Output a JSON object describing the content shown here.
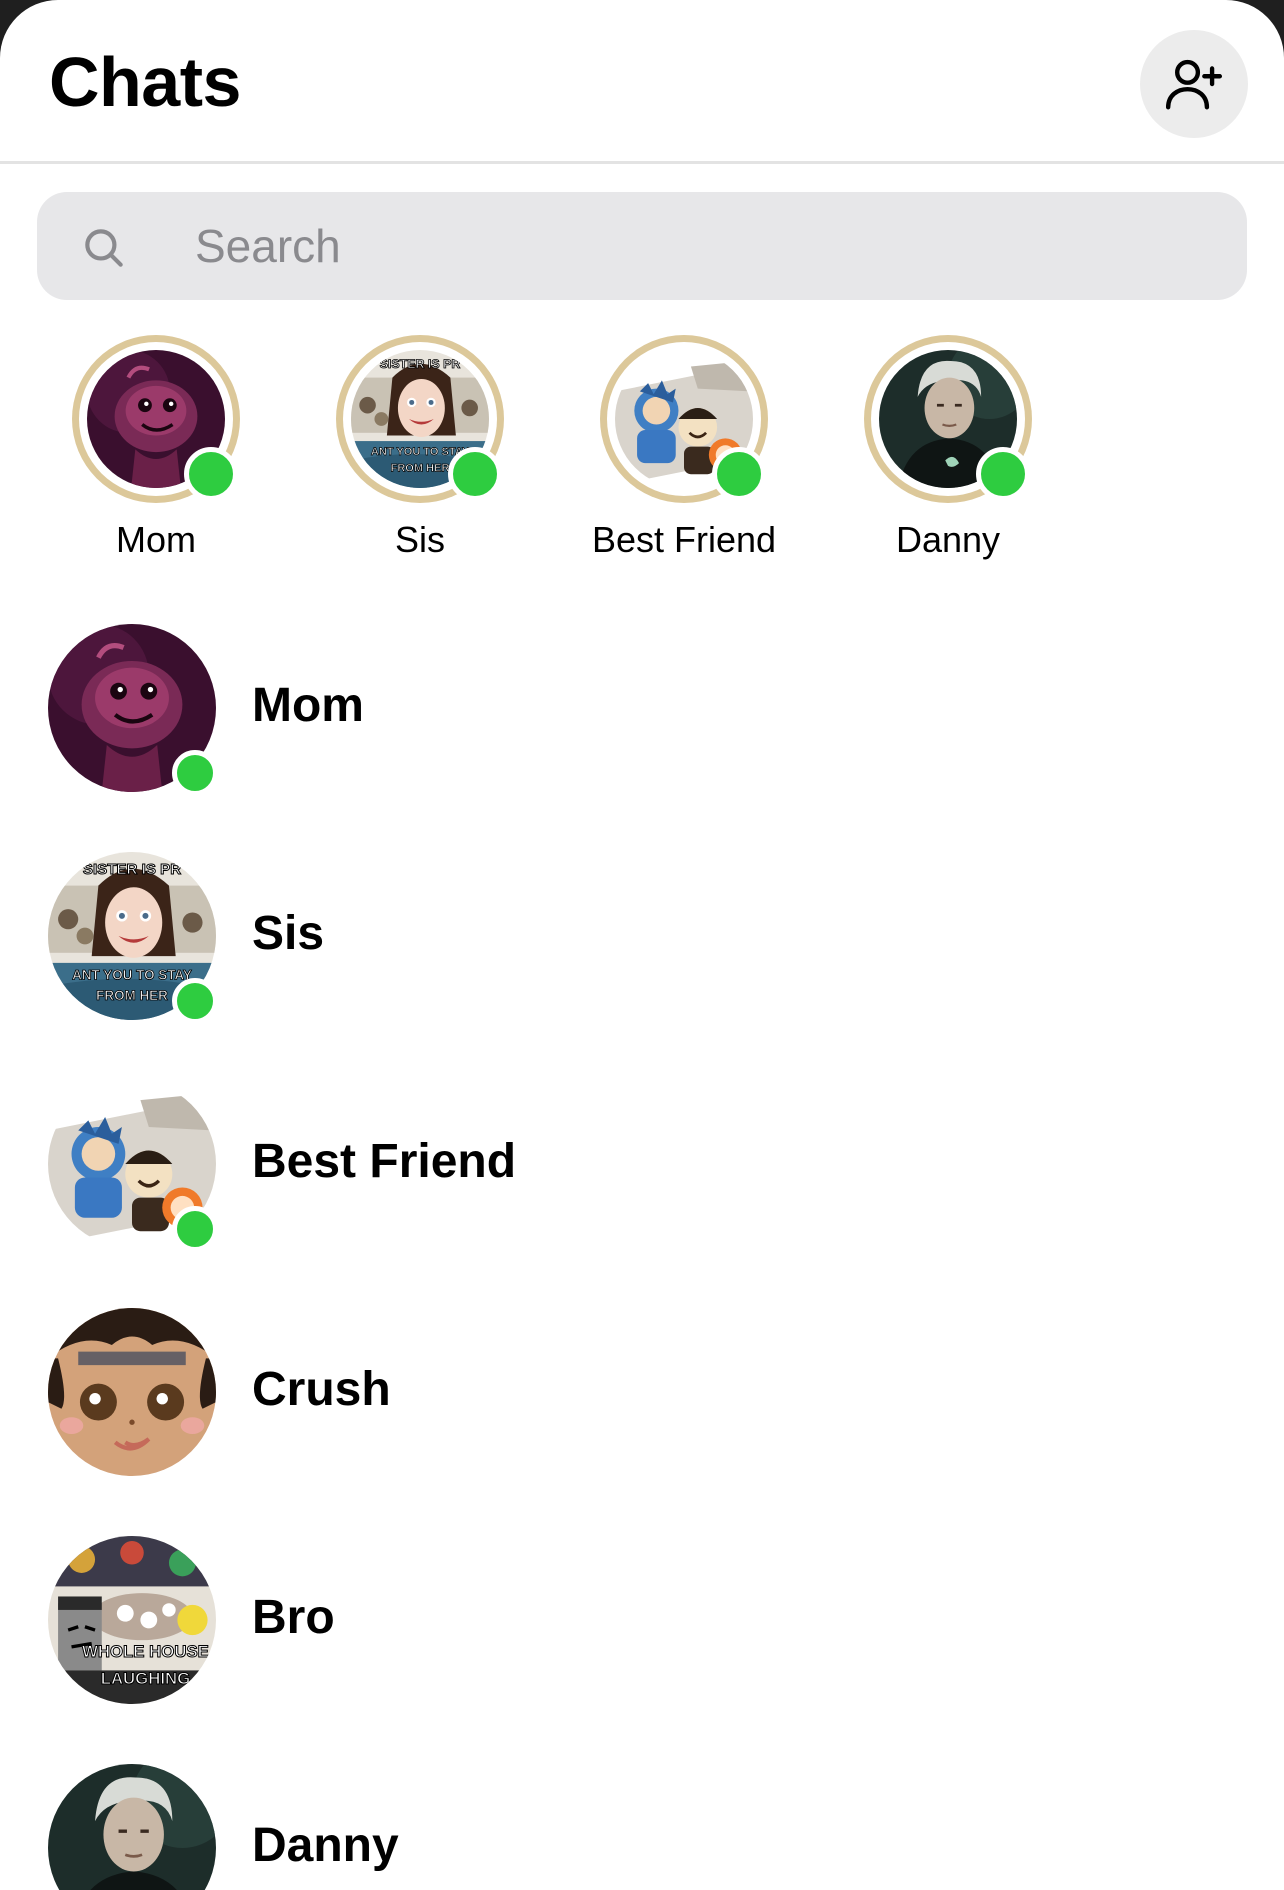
{
  "header": {
    "title": "Chats",
    "add_contact_icon": "person-add-icon"
  },
  "search": {
    "placeholder": "Search",
    "icon": "search-icon"
  },
  "colors": {
    "online": "#2ecc40",
    "story_ring": "#dcc89a",
    "search_bg": "#e7e7e9"
  },
  "stories": [
    {
      "name": "Mom",
      "online": true
    },
    {
      "name": "Sis",
      "online": true
    },
    {
      "name": "Best Friend",
      "online": true
    },
    {
      "name": "Danny",
      "online": true
    }
  ],
  "chats": [
    {
      "name": "Mom",
      "online": true
    },
    {
      "name": "Sis",
      "online": true
    },
    {
      "name": "Best Friend",
      "online": true
    },
    {
      "name": "Crush",
      "online": false
    },
    {
      "name": "Bro",
      "online": false
    },
    {
      "name": "Danny",
      "online": false
    }
  ],
  "avatar_captions": {
    "sis_top": "SISTER IS PR",
    "sis_bottom_1": "ANT YOU TO STAY",
    "sis_bottom_2": "FROM HER",
    "bro_1": "WHOLE HOUSE",
    "bro_2": "LAUGHING"
  }
}
